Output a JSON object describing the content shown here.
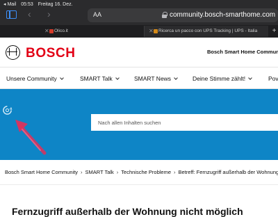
{
  "status_bar": {
    "back_app": "◂ Mail",
    "time": "05:53",
    "date": "Freitag 16. Dez."
  },
  "browser": {
    "text_size_button": "AA",
    "url": "community.bosch-smarthome.com",
    "tabs": [
      {
        "label": "Olico.it",
        "favicon_color": "#d43b2a"
      },
      {
        "label": "Ricerca un pacco con UPS Tracking | UPS - Italia",
        "favicon_color": "#d48a1a"
      }
    ],
    "new_tab": "+"
  },
  "site": {
    "brand": "BOSCH",
    "title": "Bosch Smart Home Communit"
  },
  "nav": {
    "items": [
      {
        "label": "Unsere Community"
      },
      {
        "label": "SMART Talk"
      },
      {
        "label": "SMART News"
      },
      {
        "label": "Deine Stimme zählt!"
      },
      {
        "label": "Pov"
      }
    ]
  },
  "hero": {
    "search_placeholder": "Nach allen Inhalten suchen",
    "accent_color": "#0e85c6"
  },
  "breadcrumb": {
    "items": [
      "Bosch Smart Home Community",
      "SMART Talk",
      "Technische Probleme",
      "Betreff: Fernzugriff außerhalb der Wohnung"
    ]
  },
  "thread": {
    "title": "Fernzugriff außerhalb der Wohnung nicht möglich"
  },
  "icons": {
    "sidebar": "sidebar-icon",
    "back": "chevron-left-icon",
    "forward": "chevron-right-icon",
    "lock": "lock-icon",
    "logo": "bosch-armature-icon",
    "loading": "loading-icon",
    "annotation": "red-arrow-annotation"
  }
}
